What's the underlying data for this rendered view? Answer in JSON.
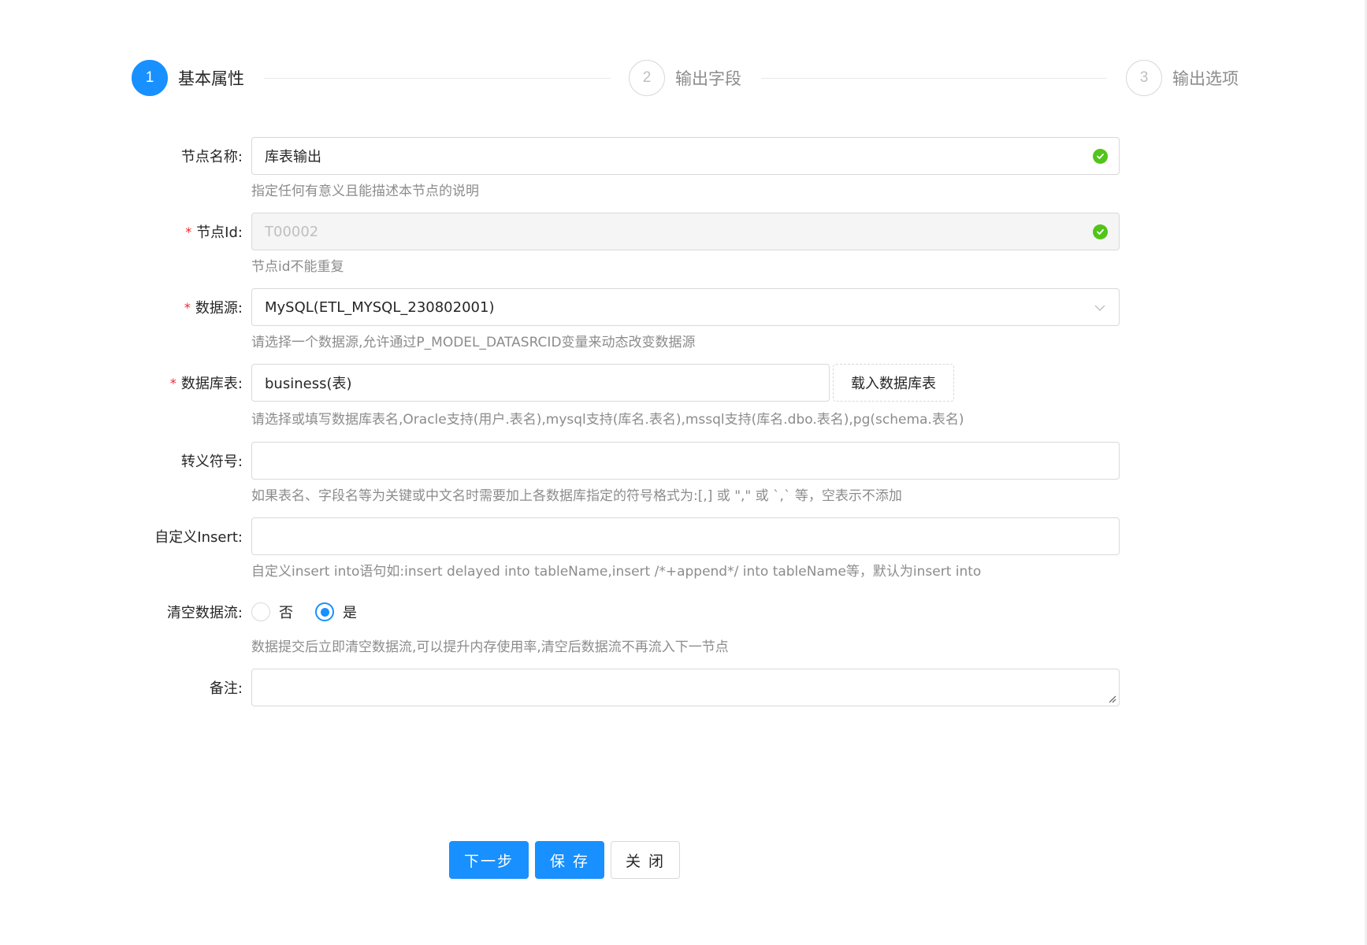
{
  "steps": [
    {
      "number": "1",
      "title": "基本属性",
      "status": "active"
    },
    {
      "number": "2",
      "title": "输出字段",
      "status": "wait"
    },
    {
      "number": "3",
      "title": "输出选项",
      "status": "wait"
    }
  ],
  "form": {
    "node_name": {
      "label": "节点名称:",
      "value": "库表输出",
      "help": "指定任何有意义且能描述本节点的说明"
    },
    "node_id": {
      "label": "节点Id:",
      "value": "T00002",
      "help": "节点id不能重复"
    },
    "datasource": {
      "label": "数据源:",
      "value": "MySQL(ETL_MYSQL_230802001)",
      "help": "请选择一个数据源,允许通过P_MODEL_DATASRCID变量来动态改变数据源"
    },
    "db_table": {
      "label": "数据库表:",
      "value": "business(表)",
      "button": "载入数据库表",
      "help": "请选择或填写数据库表名,Oracle支持(用户.表名),mysql支持(库名.表名),mssql支持(库名.dbo.表名),pg(schema.表名)"
    },
    "escape_symbol": {
      "label": "转义符号:",
      "value": "",
      "help": "如果表名、字段名等为关键或中文名时需要加上各数据库指定的符号格式为:[,] 或 \",\" 或 `,` 等，空表示不添加"
    },
    "custom_insert": {
      "label": "自定义Insert:",
      "value": "",
      "help": "自定义insert into语句如:insert delayed into tableName,insert /*+append*/ into tableName等，默认为insert into"
    },
    "clear_stream": {
      "label": "清空数据流:",
      "options": [
        "否",
        "是"
      ],
      "selected": "是",
      "help": "数据提交后立即清空数据流,可以提升内存使用率,清空后数据流不再流入下一节点"
    },
    "remark": {
      "label": "备注:",
      "value": ""
    }
  },
  "buttons": {
    "next": "下一步",
    "save": "保 存",
    "close": "关 闭"
  },
  "colors": {
    "primary": "#1890ff",
    "success": "#52c41a",
    "required": "#f5222d"
  }
}
